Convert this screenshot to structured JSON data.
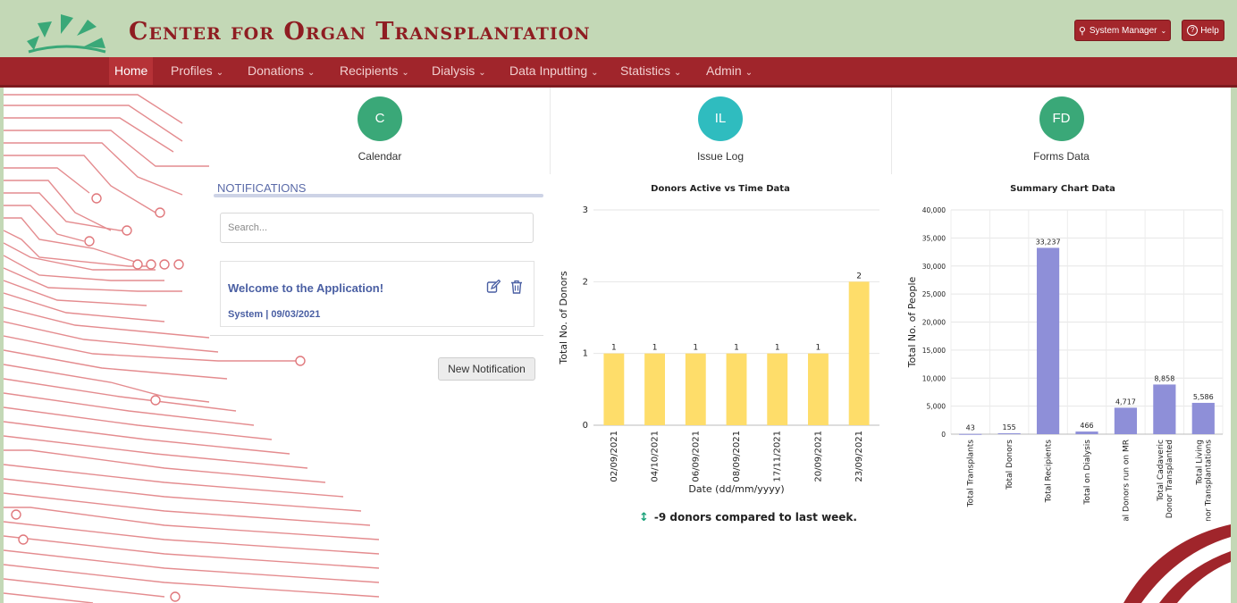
{
  "header": {
    "title": "Center for Organ Transplantation",
    "user_label": "System Manager",
    "help_label": "Help"
  },
  "nav": {
    "items": [
      "Home",
      "Profiles",
      "Donations",
      "Recipients",
      "Dialysis",
      "Data Inputting",
      "Statistics",
      "Admin"
    ],
    "active": "Home"
  },
  "tiles": [
    {
      "initials": "C",
      "label": "Calendar",
      "color": "#3aa878"
    },
    {
      "initials": "IL",
      "label": "Issue Log",
      "color": "#2fbcbf"
    },
    {
      "initials": "FD",
      "label": "Forms Data",
      "color": "#3aa878"
    }
  ],
  "notifications": {
    "title": "NOTIFICATIONS",
    "search_placeholder": "Search...",
    "items": [
      {
        "title": "Welcome to the Application!",
        "meta": "System | 09/03/2021"
      }
    ],
    "new_button": "New Notification"
  },
  "donors_footer": "-9 donors compared to last week.",
  "colors": {
    "brand": "#8f1d22",
    "nav": "#a0252b",
    "bar_yellow": "#fedd6a",
    "bar_purple": "#8e8fd8",
    "accent_green": "#1aa27a"
  },
  "chart_data": [
    {
      "type": "bar",
      "title": "Donors Active vs Time Data",
      "xlabel": "Date (dd/mm/yyyy)",
      "ylabel": "Total No. of Donors",
      "categories": [
        "02/09/2021",
        "04/10/2021",
        "06/09/2021",
        "08/09/2021",
        "17/11/2021",
        "20/09/2021",
        "23/09/2021"
      ],
      "values": [
        1,
        1,
        1,
        1,
        1,
        1,
        2
      ],
      "ylim": [
        0,
        3
      ],
      "yticks": [
        "0",
        "1",
        "2",
        "3"
      ],
      "data_labels": [
        "1",
        "1",
        "1",
        "1",
        "1",
        "1",
        "2"
      ],
      "grid": true
    },
    {
      "type": "bar",
      "title": "Summary Chart Data",
      "xlabel": "",
      "ylabel": "Total No. of People",
      "categories": [
        "Total Transplants",
        "Total Donors",
        "Total Recipients",
        "Total on Dialysis",
        "Total Donors run on MR",
        "Total Cadaveric Donor Transplanted",
        "Total Living Donor Transplantations"
      ],
      "values": [
        43,
        155,
        33237,
        466,
        4717,
        8858,
        5586
      ],
      "ylim": [
        0,
        40000
      ],
      "yticks": [
        "0",
        "5,000",
        "10,000",
        "15,000",
        "20,000",
        "25,000",
        "30,000",
        "35,000",
        "40,000"
      ],
      "data_labels": [
        "43",
        "155",
        "33,237",
        "466",
        "4,717",
        "8,858",
        "5,586"
      ],
      "grid": true
    }
  ]
}
